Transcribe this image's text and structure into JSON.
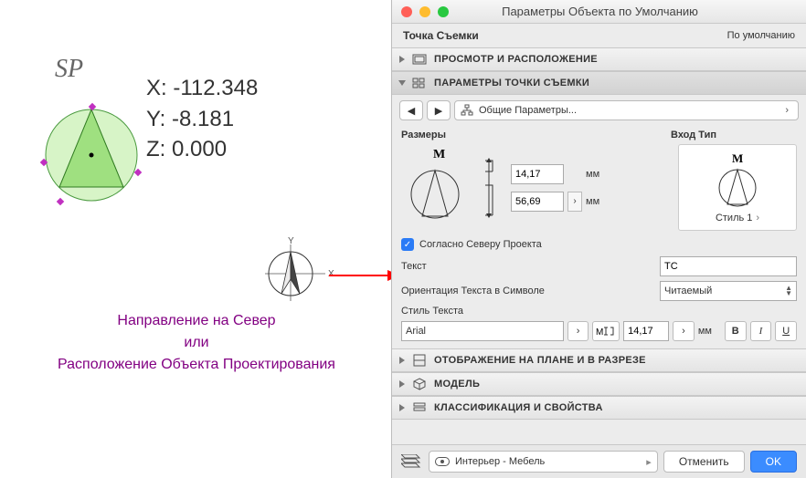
{
  "canvas": {
    "sp_label": "SP",
    "coords": {
      "x": "X: -112.348",
      "y": "Y: -8.181",
      "z": "Z: 0.000"
    },
    "compass": {
      "y_axis": "Y",
      "x_axis": "X"
    },
    "caption_line1": "Направление на Север",
    "caption_line2": "или",
    "caption_line3": "Расположение Объекта Проектирования"
  },
  "panel": {
    "title": "Параметры Объекта по Умолчанию",
    "survey_point": "Точка Съемки",
    "default_link": "По умолчанию",
    "sections": {
      "preview": "ПРОСМОТР И РАСПОЛОЖЕНИЕ",
      "params": "ПАРАМЕТРЫ ТОЧКИ СЪЕМКИ",
      "display": "ОТОБРАЖЕНИЕ НА ПЛАНЕ И В РАЗРЕЗЕ",
      "model": "МОДЕЛЬ",
      "class": "КЛАССИФИКАЦИЯ И СВОЙСТВА"
    },
    "nav_path": "Общие Параметры...",
    "sizes_label": "Размеры",
    "type_label": "Вход Тип",
    "m_label": "M",
    "size1": "14,17",
    "size2": "56,69",
    "unit": "мм",
    "style1": "Стиль 1",
    "checkbox_label": "Согласно Северу Проекта",
    "fields": {
      "text_label": "Текст",
      "text_value": "ТС",
      "orient_label": "Ориентация Текста в Символе",
      "orient_value": "Читаемый",
      "textstyle_label": "Стиль Текста",
      "font": "Arial",
      "font_size": "14,17"
    },
    "footer": {
      "layer": "Интерьер - Мебель",
      "cancel": "Отменить",
      "ok": "OK"
    }
  }
}
